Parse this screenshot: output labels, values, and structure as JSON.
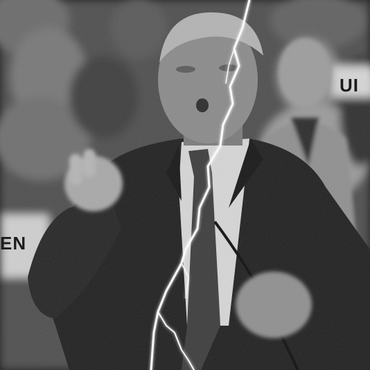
{
  "image": {
    "style": "grayscale",
    "sign_left_text": "EN",
    "sign_right_text": "UI",
    "colors": {
      "background": "#5a5a5a",
      "suit": "#1e1e1e",
      "shirt": "#d8d8d8",
      "tie": "#3a3a3a",
      "skin": "#8c8c8c",
      "lightning": "#ffffff"
    }
  }
}
